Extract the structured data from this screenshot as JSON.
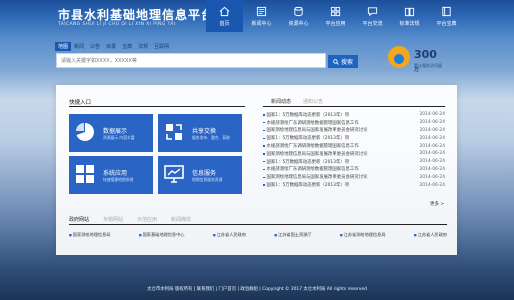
{
  "header": {
    "title": "市县水利基础地理信息平台",
    "subtitle": "TAICANG SHUI LI JI CHU DI LI XIN XI PING TAI"
  },
  "nav": [
    {
      "label": "首页",
      "icon": "home-icon"
    },
    {
      "label": "新闻中心",
      "icon": "news-icon"
    },
    {
      "label": "资源中心",
      "icon": "resource-icon"
    },
    {
      "label": "平台应用",
      "icon": "app-icon"
    },
    {
      "label": "平台交流",
      "icon": "chat-icon"
    },
    {
      "label": "标准法规",
      "icon": "book-icon"
    },
    {
      "label": "平台宝典",
      "icon": "manual-icon"
    }
  ],
  "search": {
    "categories": [
      "地图",
      "新闻",
      "公告",
      "目录",
      "宝典",
      "法规",
      "互联网"
    ],
    "placeholder": "请输入关键字如XXXX，XXXXX等",
    "button_label": "搜索"
  },
  "stat": {
    "number": "300",
    "unit": "万",
    "label": "累计服务访问量"
  },
  "quick": {
    "title": "快捷入口",
    "tiles": [
      {
        "title": "数据展示",
        "desc": "资源展示 内容丰富",
        "icon": "chart-icon"
      },
      {
        "title": "共享交换",
        "desc": "服务发布、整合、获取",
        "icon": "share-icon"
      },
      {
        "title": "系统应用",
        "desc": "快速搭建地图系统",
        "icon": "app-icon"
      },
      {
        "title": "信息服务",
        "desc": "地理信息服务资源",
        "icon": "monitor-icon"
      }
    ]
  },
  "news": {
    "tabs": [
      "新闻动态",
      "通知公告"
    ],
    "items": [
      {
        "text": "国家1：5万数据库动态更新（2013年）项",
        "date": "2014-06-24"
      },
      {
        "text": "水规部测绘广东调研测绘数据管理国家信息工作",
        "date": "2014-06-24"
      },
      {
        "text": "国家测绘地理信息局与国家发展改革委员会研究讨论",
        "date": "2014-06-24"
      },
      {
        "text": "国家1：5万数据库动态更新（2013年）项",
        "date": "2014-06-24"
      },
      {
        "text": "水规部测绘广东调研测绘数据管理国家信息工作",
        "date": "2014-06-24"
      },
      {
        "text": "国家测绘地理信息局与国家发展改革委员会研究讨论",
        "date": "2014-06-24"
      },
      {
        "text": "国家1：5万数据库动态更新（2013年）项",
        "date": "2014-06-24"
      },
      {
        "text": "水规部测绘广东调研测绘数据管理国家信息工作",
        "date": "2014-06-24"
      },
      {
        "text": "国家测绘地理信息局与国家发展改革委员会研究讨论",
        "date": "2014-06-24"
      },
      {
        "text": "国家1：5万数据库动态更新（2013年）项",
        "date": "2014-06-24"
      }
    ],
    "more": "更多 >"
  },
  "links": {
    "tabs": [
      "政府网站",
      "专题网站",
      "示范应用",
      "新闻媒体"
    ],
    "items": [
      "国家测绘地理信息局",
      "国家基础地理信息中心",
      "江苏省人民政府",
      "江苏省国土资源厅",
      "江苏省测绘地理信息局",
      "江苏省人民政府"
    ]
  },
  "footer": {
    "text": "太仓市水利局  版权所有 | 联系我们 | 门户首页 | 政治群组 | Copyright © 2017 太仓水利局 All rights reserved"
  }
}
